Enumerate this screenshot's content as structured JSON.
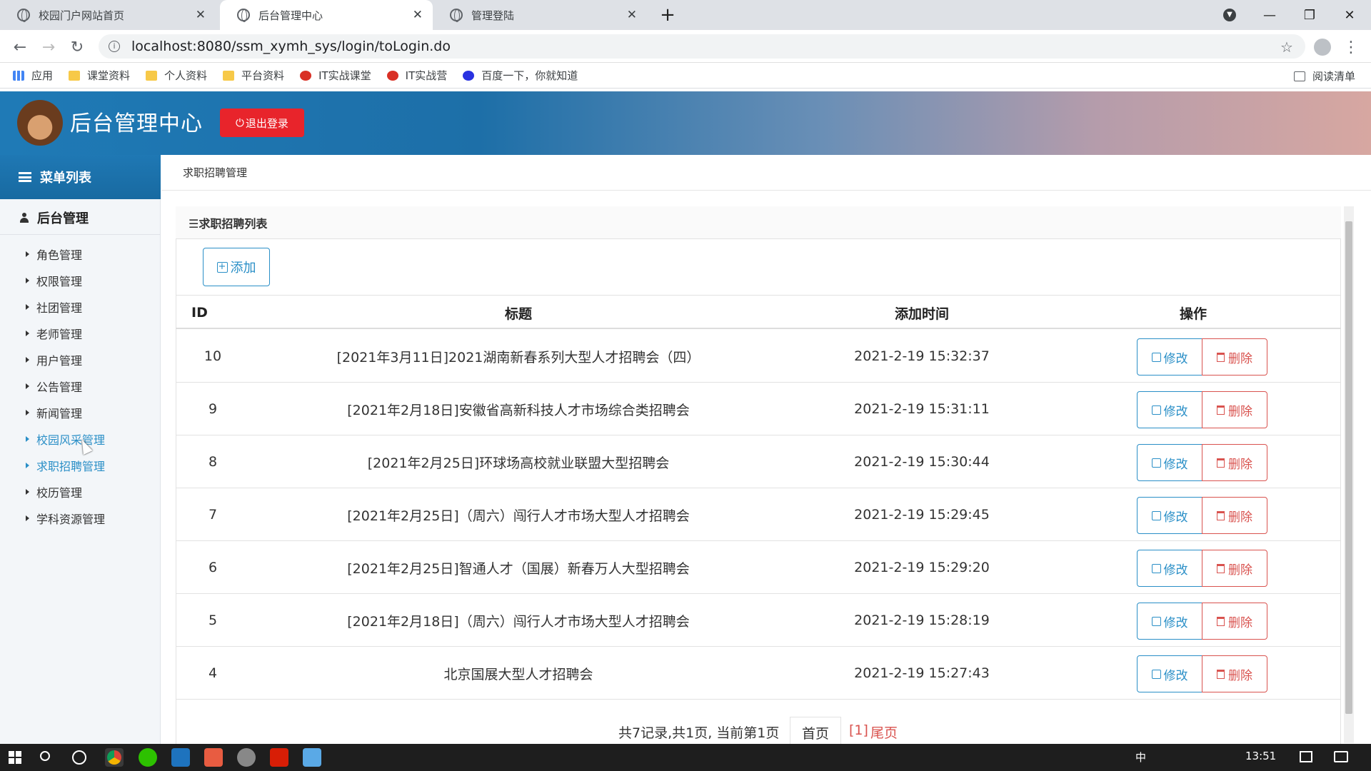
{
  "browser": {
    "tabs": [
      {
        "title": "校园门户网站首页",
        "active": false
      },
      {
        "title": "后台管理中心",
        "active": true
      },
      {
        "title": "管理登陆",
        "active": false
      }
    ],
    "url": "localhost:8080/ssm_xymh_sys/login/toLogin.do",
    "bookmarks": [
      "应用",
      "课堂资料",
      "个人资料",
      "平台资料",
      "IT实战课堂",
      "IT实战营",
      "百度一下，你就知道"
    ],
    "reading_list": "阅读清单"
  },
  "header": {
    "title": "后台管理中心",
    "logout_label": "退出登录"
  },
  "sidebar": {
    "menu_title": "菜单列表",
    "group_title": "后台管理",
    "items": [
      {
        "label": "角色管理"
      },
      {
        "label": "权限管理"
      },
      {
        "label": "社团管理"
      },
      {
        "label": "老师管理"
      },
      {
        "label": "用户管理"
      },
      {
        "label": "公告管理"
      },
      {
        "label": "新闻管理"
      },
      {
        "label": "校园风采管理"
      },
      {
        "label": "求职招聘管理"
      },
      {
        "label": "校历管理"
      },
      {
        "label": "学科资源管理"
      }
    ]
  },
  "main": {
    "breadcrumb": "求职招聘管理",
    "panel_title": "☰求职招聘列表",
    "add_label": "添加",
    "columns": [
      "ID",
      "标题",
      "添加时间",
      "操作"
    ],
    "edit_label": "修改",
    "delete_label": "删除",
    "rows": [
      {
        "id": "10",
        "title": "[2021年3月11日]2021湖南新春系列大型人才招聘会（四）",
        "time": "2021-2-19 15:32:37"
      },
      {
        "id": "9",
        "title": "[2021年2月18日]安徽省高新科技人才市场综合类招聘会",
        "time": "2021-2-19 15:31:11"
      },
      {
        "id": "8",
        "title": "[2021年2月25日]环球场高校就业联盟大型招聘会",
        "time": "2021-2-19 15:30:44"
      },
      {
        "id": "7",
        "title": "[2021年2月25日]（周六）闯行人才市场大型人才招聘会",
        "time": "2021-2-19 15:29:45"
      },
      {
        "id": "6",
        "title": "[2021年2月25日]智通人才（国展）新春万人大型招聘会",
        "time": "2021-2-19 15:29:20"
      },
      {
        "id": "5",
        "title": "[2021年2月18日]（周六）闯行人才市场大型人才招聘会",
        "time": "2021-2-19 15:28:19"
      },
      {
        "id": "4",
        "title": "北京国展大型人才招聘会",
        "time": "2021-2-19 15:27:43"
      }
    ],
    "pager": {
      "summary": "共7记录,共1页, 当前第1页",
      "first": "首页",
      "current": "[1]",
      "last": "尾页"
    }
  },
  "taskbar": {
    "ime": "中",
    "clock": "13:51"
  },
  "colors": {
    "accent": "#2a8fc7",
    "danger": "#e8242b",
    "header_gradient_start": "#1f7ab6",
    "header_gradient_end": "#d7a7a1"
  }
}
